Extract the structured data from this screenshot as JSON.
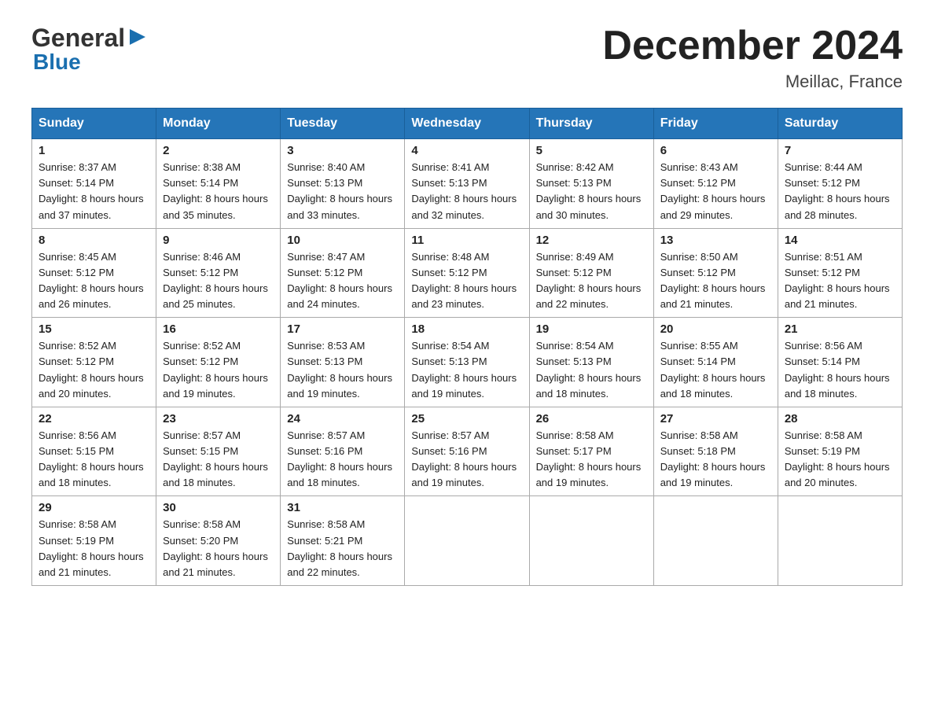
{
  "header": {
    "logo_general": "General",
    "logo_blue": "Blue",
    "month_title": "December 2024",
    "location": "Meillac, France"
  },
  "days_of_week": [
    "Sunday",
    "Monday",
    "Tuesday",
    "Wednesday",
    "Thursday",
    "Friday",
    "Saturday"
  ],
  "weeks": [
    [
      {
        "day": "1",
        "sunrise": "8:37 AM",
        "sunset": "5:14 PM",
        "daylight": "8 hours and 37 minutes."
      },
      {
        "day": "2",
        "sunrise": "8:38 AM",
        "sunset": "5:14 PM",
        "daylight": "8 hours and 35 minutes."
      },
      {
        "day": "3",
        "sunrise": "8:40 AM",
        "sunset": "5:13 PM",
        "daylight": "8 hours and 33 minutes."
      },
      {
        "day": "4",
        "sunrise": "8:41 AM",
        "sunset": "5:13 PM",
        "daylight": "8 hours and 32 minutes."
      },
      {
        "day": "5",
        "sunrise": "8:42 AM",
        "sunset": "5:13 PM",
        "daylight": "8 hours and 30 minutes."
      },
      {
        "day": "6",
        "sunrise": "8:43 AM",
        "sunset": "5:12 PM",
        "daylight": "8 hours and 29 minutes."
      },
      {
        "day": "7",
        "sunrise": "8:44 AM",
        "sunset": "5:12 PM",
        "daylight": "8 hours and 28 minutes."
      }
    ],
    [
      {
        "day": "8",
        "sunrise": "8:45 AM",
        "sunset": "5:12 PM",
        "daylight": "8 hours and 26 minutes."
      },
      {
        "day": "9",
        "sunrise": "8:46 AM",
        "sunset": "5:12 PM",
        "daylight": "8 hours and 25 minutes."
      },
      {
        "day": "10",
        "sunrise": "8:47 AM",
        "sunset": "5:12 PM",
        "daylight": "8 hours and 24 minutes."
      },
      {
        "day": "11",
        "sunrise": "8:48 AM",
        "sunset": "5:12 PM",
        "daylight": "8 hours and 23 minutes."
      },
      {
        "day": "12",
        "sunrise": "8:49 AM",
        "sunset": "5:12 PM",
        "daylight": "8 hours and 22 minutes."
      },
      {
        "day": "13",
        "sunrise": "8:50 AM",
        "sunset": "5:12 PM",
        "daylight": "8 hours and 21 minutes."
      },
      {
        "day": "14",
        "sunrise": "8:51 AM",
        "sunset": "5:12 PM",
        "daylight": "8 hours and 21 minutes."
      }
    ],
    [
      {
        "day": "15",
        "sunrise": "8:52 AM",
        "sunset": "5:12 PM",
        "daylight": "8 hours and 20 minutes."
      },
      {
        "day": "16",
        "sunrise": "8:52 AM",
        "sunset": "5:12 PM",
        "daylight": "8 hours and 19 minutes."
      },
      {
        "day": "17",
        "sunrise": "8:53 AM",
        "sunset": "5:13 PM",
        "daylight": "8 hours and 19 minutes."
      },
      {
        "day": "18",
        "sunrise": "8:54 AM",
        "sunset": "5:13 PM",
        "daylight": "8 hours and 19 minutes."
      },
      {
        "day": "19",
        "sunrise": "8:54 AM",
        "sunset": "5:13 PM",
        "daylight": "8 hours and 18 minutes."
      },
      {
        "day": "20",
        "sunrise": "8:55 AM",
        "sunset": "5:14 PM",
        "daylight": "8 hours and 18 minutes."
      },
      {
        "day": "21",
        "sunrise": "8:56 AM",
        "sunset": "5:14 PM",
        "daylight": "8 hours and 18 minutes."
      }
    ],
    [
      {
        "day": "22",
        "sunrise": "8:56 AM",
        "sunset": "5:15 PM",
        "daylight": "8 hours and 18 minutes."
      },
      {
        "day": "23",
        "sunrise": "8:57 AM",
        "sunset": "5:15 PM",
        "daylight": "8 hours and 18 minutes."
      },
      {
        "day": "24",
        "sunrise": "8:57 AM",
        "sunset": "5:16 PM",
        "daylight": "8 hours and 18 minutes."
      },
      {
        "day": "25",
        "sunrise": "8:57 AM",
        "sunset": "5:16 PM",
        "daylight": "8 hours and 19 minutes."
      },
      {
        "day": "26",
        "sunrise": "8:58 AM",
        "sunset": "5:17 PM",
        "daylight": "8 hours and 19 minutes."
      },
      {
        "day": "27",
        "sunrise": "8:58 AM",
        "sunset": "5:18 PM",
        "daylight": "8 hours and 19 minutes."
      },
      {
        "day": "28",
        "sunrise": "8:58 AM",
        "sunset": "5:19 PM",
        "daylight": "8 hours and 20 minutes."
      }
    ],
    [
      {
        "day": "29",
        "sunrise": "8:58 AM",
        "sunset": "5:19 PM",
        "daylight": "8 hours and 21 minutes."
      },
      {
        "day": "30",
        "sunrise": "8:58 AM",
        "sunset": "5:20 PM",
        "daylight": "8 hours and 21 minutes."
      },
      {
        "day": "31",
        "sunrise": "8:58 AM",
        "sunset": "5:21 PM",
        "daylight": "8 hours and 22 minutes."
      },
      null,
      null,
      null,
      null
    ]
  ],
  "sunrise_label": "Sunrise:",
  "sunset_label": "Sunset:",
  "daylight_label": "Daylight:"
}
